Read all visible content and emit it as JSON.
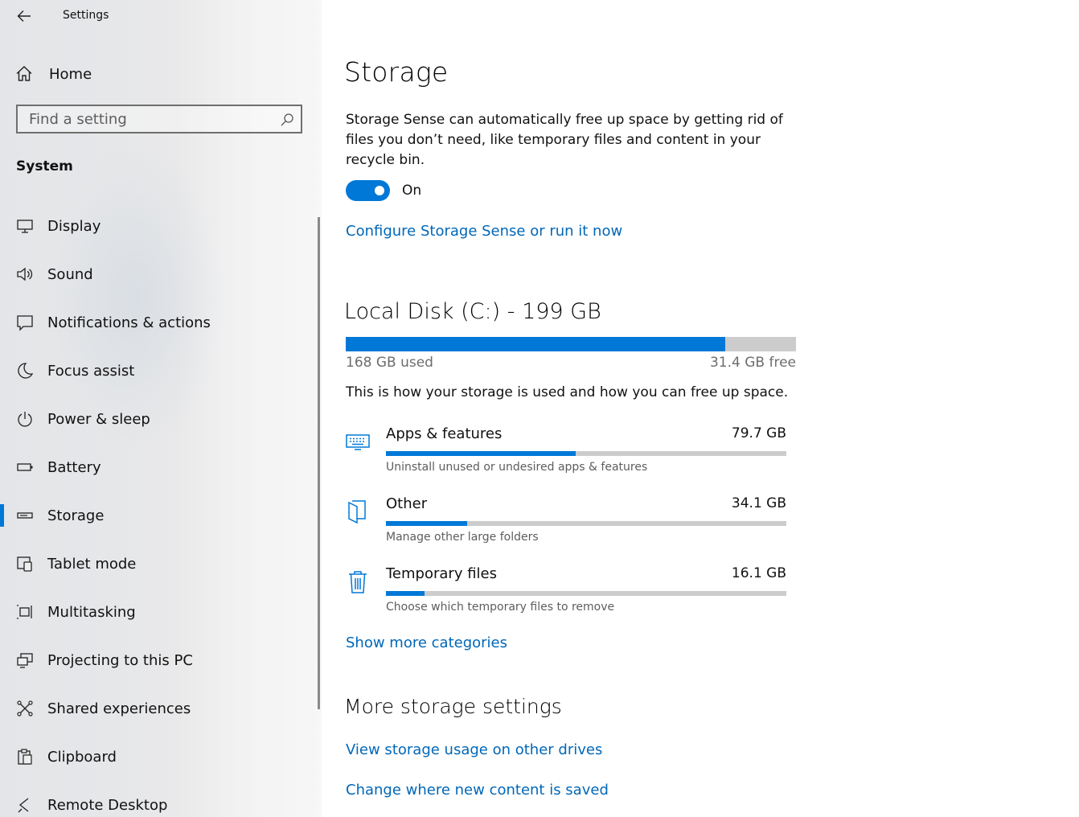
{
  "window": {
    "title": "Settings"
  },
  "sidebar": {
    "home_label": "Home",
    "search_placeholder": "Find a setting",
    "section_label": "System",
    "items": [
      {
        "label": "Display",
        "icon": "display-icon"
      },
      {
        "label": "Sound",
        "icon": "speaker-icon"
      },
      {
        "label": "Notifications & actions",
        "icon": "notification-icon"
      },
      {
        "label": "Focus assist",
        "icon": "moon-icon"
      },
      {
        "label": "Power & sleep",
        "icon": "power-icon"
      },
      {
        "label": "Battery",
        "icon": "battery-icon"
      },
      {
        "label": "Storage",
        "icon": "drive-icon",
        "active": true
      },
      {
        "label": "Tablet mode",
        "icon": "tablet-mode-icon"
      },
      {
        "label": "Multitasking",
        "icon": "multitasking-icon"
      },
      {
        "label": "Projecting to this PC",
        "icon": "projecting-icon"
      },
      {
        "label": "Shared experiences",
        "icon": "shared-experiences-icon"
      },
      {
        "label": "Clipboard",
        "icon": "clipboard-icon"
      },
      {
        "label": "Remote Desktop",
        "icon": "remote-desktop-icon"
      }
    ]
  },
  "main": {
    "title": "Storage",
    "description": "Storage Sense can automatically free up space by getting rid of files you don’t need, like temporary files and content in your recycle bin.",
    "toggle": {
      "state_label": "On",
      "on": true
    },
    "configure_link": "Configure Storage Sense or run it now",
    "disk": {
      "title": "Local Disk (C:) - 199 GB",
      "used_label": "168 GB used",
      "free_label": "31.4 GB free",
      "used_fraction": 0.843
    },
    "info_text": "This is how your storage is used and how you can free up space.",
    "categories": [
      {
        "name": "Apps & features",
        "size": "79.7 GB",
        "subtitle": "Uninstall unused or undesired apps & features",
        "fraction": 0.474,
        "icon": "keyboard-icon"
      },
      {
        "name": "Other",
        "size": "34.1 GB",
        "subtitle": "Manage other large folders",
        "fraction": 0.203,
        "icon": "folder-icon"
      },
      {
        "name": "Temporary files",
        "size": "16.1 GB",
        "subtitle": "Choose which temporary files to remove",
        "fraction": 0.096,
        "icon": "trash-icon"
      }
    ],
    "show_more_link": "Show more categories",
    "more_settings_title": "More storage settings",
    "other_drives_link": "View storage usage on other drives",
    "new_content_link": "Change where new content is saved"
  },
  "colors": {
    "accent": "#0078d7",
    "link": "#0067b8",
    "bar_track": "#cccccc"
  }
}
